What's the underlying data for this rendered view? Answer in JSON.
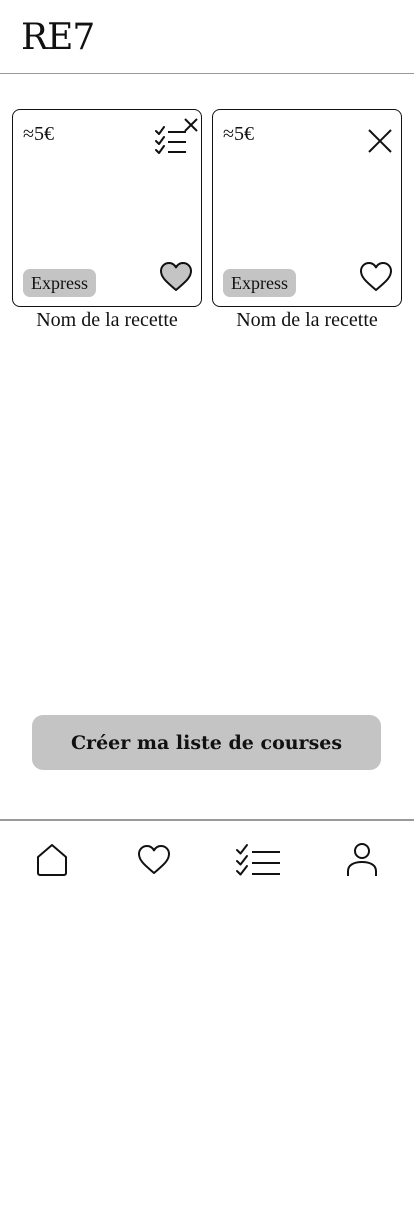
{
  "app": {
    "logo": "RE7"
  },
  "recipes": [
    {
      "price": "≈5€",
      "tag": "Express",
      "name": "Nom de la recette",
      "icons": [
        "checklist-icon",
        "close-icon",
        "heart-icon"
      ],
      "favorited": true
    },
    {
      "price": "≈5€",
      "tag": "Express",
      "name": "Nom de la recette",
      "icons": [
        "close-icon",
        "heart-icon"
      ],
      "favorited": false
    }
  ],
  "cta": {
    "label": "Créer ma liste de courses"
  },
  "nav": {
    "items": [
      "home-icon",
      "heart-icon",
      "checklist-icon",
      "profile-icon"
    ]
  },
  "colors": {
    "text": "#111111",
    "tag_background": "#c4c4c4",
    "button_background": "#c4c4c4",
    "divider": "#9a9a9a",
    "heart_fill_favorited": "#c4c4c4"
  }
}
